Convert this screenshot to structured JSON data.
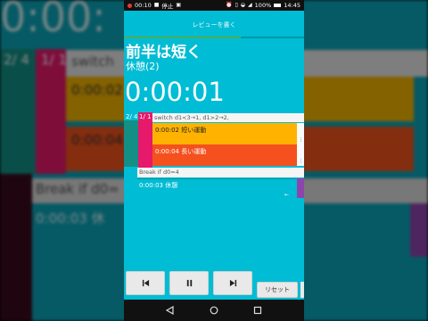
{
  "background": {
    "time": "0:00:",
    "index_a": "2/ 4",
    "index_b": "1/ 1",
    "switch_text": "switch",
    "yellow_text": "0:00:02",
    "orange_text": "0:00:04",
    "break_text": "Break if d0=",
    "rest_text": "0:00:03 休"
  },
  "status_bar": {
    "time_left": "00:10",
    "stop_label": "停止",
    "battery": "100%",
    "time_right": "14:45"
  },
  "header": {
    "review_label": "レビューを書く",
    "progress_fraction": 0.65
  },
  "main": {
    "title": "前半は短く",
    "subtitle": "休憩(2)",
    "timer": "0:00:01"
  },
  "program": {
    "index_a": "2/ 4",
    "index_b": "1/ 1",
    "switch_row": "switch d1<3→1, d1>2→2,",
    "yellow_row": "0:00:02 短い運動",
    "orange_row": "0:00:04 長い運動",
    "break_row": "Break if d0=4",
    "rest_row": "0:00:03 休憩"
  },
  "controls": {
    "prev_icon": "skip-previous-icon",
    "pause_icon": "pause-icon",
    "next_icon": "skip-next-icon",
    "reset_label": "リセット"
  },
  "navbar": {
    "back_icon": "back-triangle-icon",
    "home_icon": "home-circle-icon",
    "recents_icon": "recents-square-icon"
  },
  "colors": {
    "teal": "#00bcd4",
    "yellow": "#ffb300",
    "orange": "#f4511e",
    "pink": "#e6196b",
    "purple": "#8e44ad",
    "green_progress": "#4caf50"
  }
}
